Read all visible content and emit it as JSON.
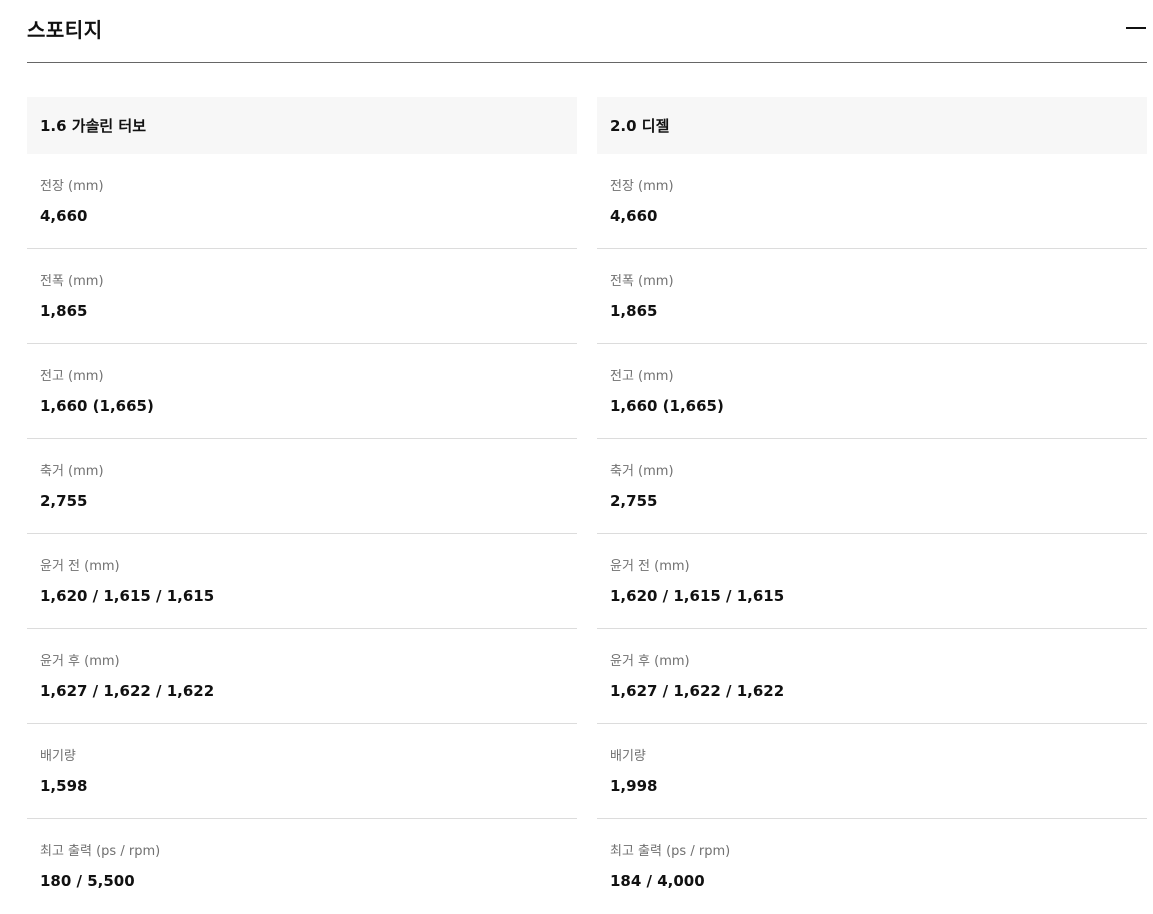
{
  "section": {
    "title": "스포티지"
  },
  "columns": [
    {
      "engine": "1.6 가솔린 터보",
      "specs": [
        {
          "label": "전장 (mm)",
          "value": "4,660"
        },
        {
          "label": "전폭 (mm)",
          "value": "1,865"
        },
        {
          "label": "전고 (mm)",
          "value": "1,660 (1,665)"
        },
        {
          "label": "축거 (mm)",
          "value": "2,755"
        },
        {
          "label": "윤거 전 (mm)",
          "value": "1,620 / 1,615 / 1,615"
        },
        {
          "label": "윤거 후 (mm)",
          "value": "1,627 / 1,622 / 1,622"
        },
        {
          "label": "배기량",
          "value": "1,598"
        },
        {
          "label": "최고 출력 (ps / rpm)",
          "value": "180 / 5,500"
        }
      ]
    },
    {
      "engine": "2.0 디젤",
      "specs": [
        {
          "label": "전장 (mm)",
          "value": "4,660"
        },
        {
          "label": "전폭 (mm)",
          "value": "1,865"
        },
        {
          "label": "전고 (mm)",
          "value": "1,660 (1,665)"
        },
        {
          "label": "축거 (mm)",
          "value": "2,755"
        },
        {
          "label": "윤거 전 (mm)",
          "value": "1,620 / 1,615 / 1,615"
        },
        {
          "label": "윤거 후 (mm)",
          "value": "1,627 / 1,622 / 1,622"
        },
        {
          "label": "배기량",
          "value": "1,998"
        },
        {
          "label": "최고 출력 (ps / rpm)",
          "value": "184 / 4,000"
        }
      ]
    }
  ]
}
